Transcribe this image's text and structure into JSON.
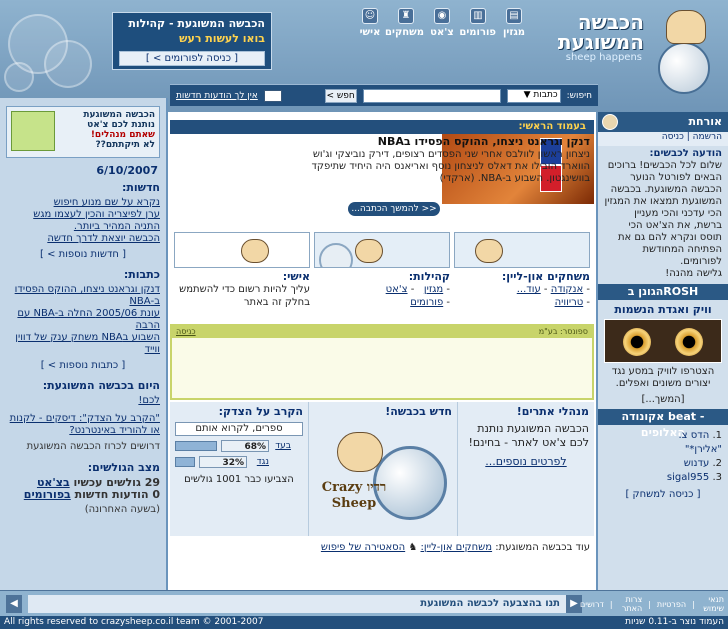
{
  "header": {
    "community_title": "הכבשה המשוגעת - קהילות",
    "community_sub": "בואו לעשות רעש",
    "community_link": "[ כניסה לפורומים > ]",
    "nav": [
      {
        "label": "מגזין",
        "icon": "magazine-icon"
      },
      {
        "label": "פורומים",
        "icon": "forums-icon"
      },
      {
        "label": "צ'אט",
        "icon": "chat-icon"
      },
      {
        "label": "משחקים",
        "icon": "trophy-icon"
      },
      {
        "label": "אישי",
        "icon": "person-icon"
      }
    ],
    "logo_text": "הכבשה המשוגעת",
    "logo_sub": "sheep happens"
  },
  "search": {
    "label": "חיפוש:",
    "select_value": "כתבות",
    "button": "חפש >",
    "news_link": "אין לך הודעות חדשות"
  },
  "left": {
    "promo_lines": [
      "הכבשה המשוגעת",
      "נותנת לכם צ'אט",
      "שאתם מנהלים!",
      "לא תיקתתם??"
    ],
    "date": "6/10/2007",
    "news_title": "חדשות:",
    "news": [
      "נקרא על שם מנוע חיפוש",
      "ערן לפיצריה והכין לעצמו מגש",
      "התניה המהיר ביותר.",
      "הכבשה יוצאת לדרך חדשה"
    ],
    "news_more": "[ חדשות נוספות > ]",
    "articles_title": "כתבות:",
    "articles": [
      "דנקן וגראנט ניצחו, ההוקס הפסידו ב-NBA",
      "עונת 2005/06 החלה ב-NBA עם הרבה",
      "השבוע בNBA משחק ענק של דווין ווייד"
    ],
    "articles_more": "[ כתבות נוספות > ]",
    "today_title": "היום בכבשה המשוגעת:",
    "today_link": "לכם!",
    "today_links": [
      "\"הקרב על הצדק\": דיסקים - לקנות",
      "או להוריד באינטרנט?"
    ],
    "today_plain": "דרושים לכרוז הכבשה המשוגעת",
    "status_title": "מצב הגולשים:",
    "status": [
      {
        "pre": "29 גולשים עכשיו",
        "link": "בצ'אט"
      },
      {
        "pre": "0 הודעות חדשות",
        "link": "בפורומים"
      }
    ],
    "status_note": "(בשעה האחרונה)"
  },
  "right": {
    "title": "אורחת",
    "sub_links": [
      "הרשמה",
      "כניסה"
    ],
    "note_title": "הודעה לכבשים:",
    "note_text": "שלום לכל הכבשים! ברוכים הבאים לפורטל הנוער הכבשה המשוגעת. בכבשה המשוגעת תמצאו את המגזין הכי עדכני והכי מעניין ברשת, את הצ'אט הכי תוסס ונקרא להם גם את הפתיחה המחודשת לפורומים.",
    "note_sign": "גלישה מהנה!",
    "rosh_bar": "הגונן בROSH",
    "week_title": "וויק ואגדת הנשמות",
    "week_caption": "הצטרפו לוויק במסע נגד יצורים משונים ואפלים.",
    "week_more": "[המשך...]",
    "rank_bar": "אקונודה beat - האלופים",
    "ranks": [
      {
        "n": "1.",
        "name": "הדס צ."
      },
      {
        "n": "",
        "name": "\"אלירן*\""
      },
      {
        "n": "2.",
        "name": "עדנוש"
      },
      {
        "n": "3.",
        "name": "sigal955"
      }
    ],
    "rank_link": "[ כניסה למשחק ]"
  },
  "main": {
    "editor_title": "בעמוד הראשי:",
    "feature_title": "דנקן וגראנט ניצחו, ההוקס הפסידו בNBA",
    "feature_text": "ניצחון ראשון לוולבס אחרי שני הפסדים רצופים, דירק נוביצקי וג'וש הווארד הובילו את דאלס לניצחון נוסף ואריאנס היה היחיד שתיפקד בוושינגטון. השבוע ב-NBA. (ארקדי)",
    "feature_continue": "<< להמשך הכתבה...",
    "cards": [
      {
        "title": "משחקים און-ליין:",
        "items": [
          "אנקודה",
          "עוד...",
          "טריוויה"
        ]
      },
      {
        "title": "קהילות:",
        "items": [
          "מגזין",
          "צ'אט",
          "פורומים"
        ]
      },
      {
        "title": "אישי:",
        "text": "עליך להיות רשום כדי להשתמש בחלק זה באתר"
      }
    ],
    "green_right": "ספונסר: בע\"מ",
    "green_left": "כניסה",
    "col1_title": "מנהלי אתרים!",
    "col1_text": "הכבשה המשוגעת נותנת לכם צ'אט לאתר - בחינם!",
    "col1_more": "לפרטים נוספים...",
    "col2_title": "חדש בכבשה!",
    "col2_name": "רדיו Crazy Sheep",
    "col3_title": "הקרב על הצדק:",
    "col3_answers": "ספרים, לקרוא אותם",
    "poll": [
      {
        "label": "בעד",
        "percent": "68%",
        "value": 0.68
      },
      {
        "label": "נגד",
        "percent": "32%",
        "value": 0.32
      }
    ],
    "poll_votes": "הצביעו כבר 1001 גולשים",
    "live_prefix": "עוד בכבשה המשוגעת:",
    "live_link1": "משחקים און-ליין:",
    "live_link2": "הסאטירה של פיפוש"
  },
  "footer": {
    "ticker": "תנו בהצבעה לכבשה המשוגעת",
    "links": [
      "תנאי שימוש",
      "הפרטיות",
      "צרות האתר",
      "דרושים"
    ],
    "copyright": "All rights reserved to crazysheep.co.il team © 2001-2007",
    "version": "העמוד נוצר ב-0.11 שניות"
  }
}
